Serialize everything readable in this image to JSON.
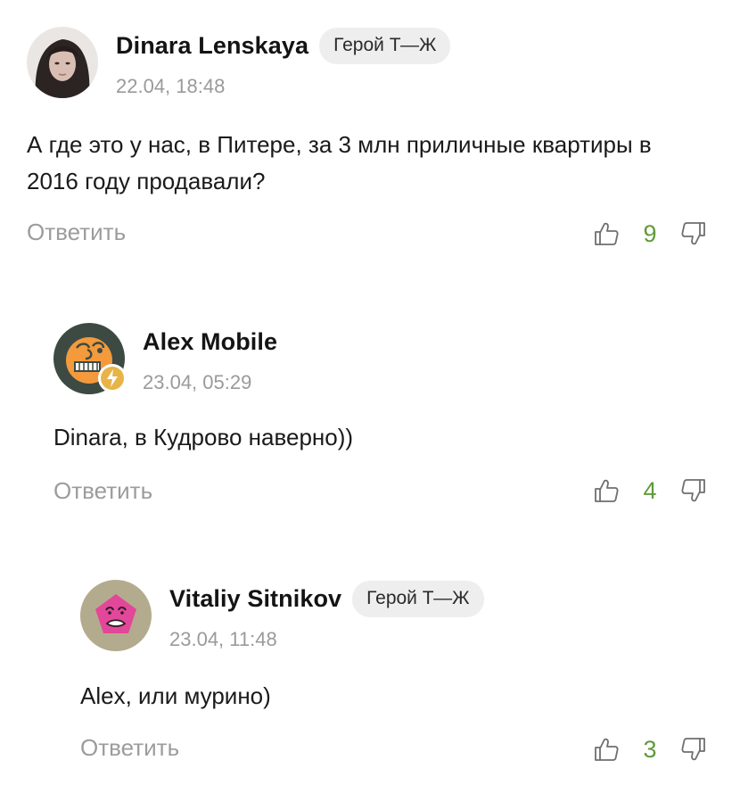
{
  "colors": {
    "score_positive": "#5f9a3a",
    "muted": "#9c9c9c",
    "badge_bg": "#eeeeee"
  },
  "comments": [
    {
      "author": "Dinara Lenskaya",
      "badge": "Герой Т—Ж",
      "date": "22.04, 18:48",
      "text": "А где это у нас, в Питере, за 3 млн приличные квартиры в 2016 году продавали?",
      "reply_label": "Ответить",
      "score": "9",
      "avatar": "user-photo-avatar"
    },
    {
      "author": "Alex Mobile",
      "date": "23.04, 05:29",
      "text": "Dinara, в Кудрово наверно))",
      "reply_label": "Ответить",
      "score": "4",
      "avatar": "orange-face-avatar",
      "avatar_badge": "lightning-badge-icon"
    },
    {
      "author": "Vitaliy Sitnikov",
      "badge": "Герой Т—Ж",
      "date": "23.04, 11:48",
      "text": "Alex, или мурино)",
      "reply_label": "Ответить",
      "score": "3",
      "avatar": "pink-pentagon-face-avatar"
    }
  ]
}
